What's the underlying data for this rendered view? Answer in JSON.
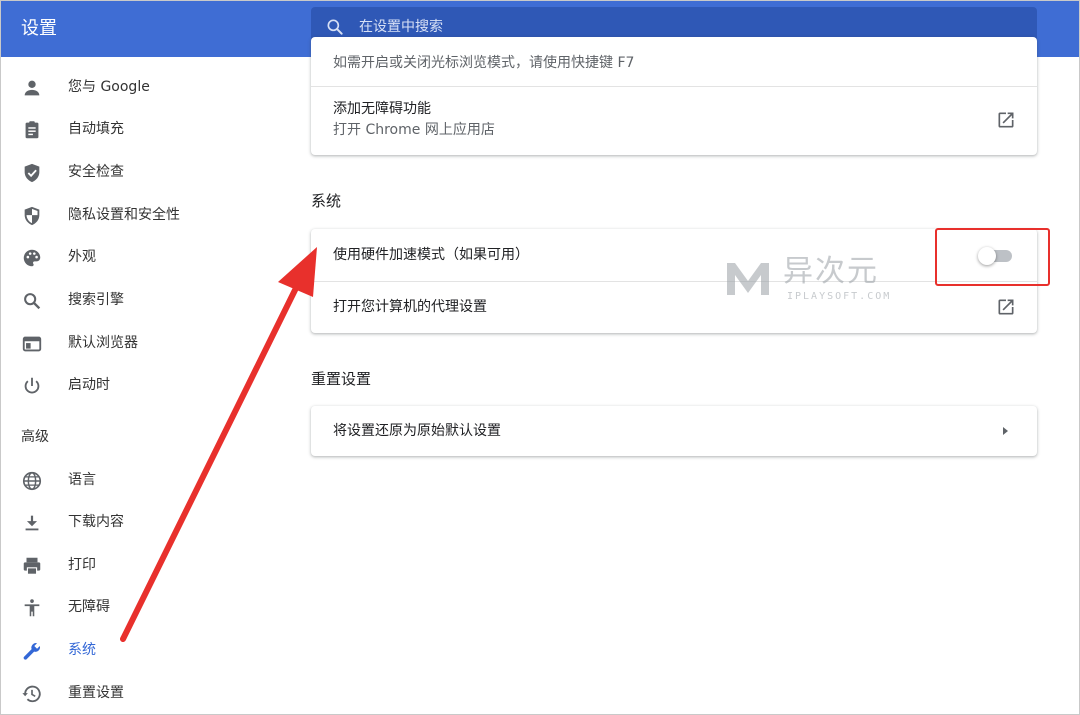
{
  "app": {
    "title": "设置"
  },
  "search": {
    "placeholder": "在设置中搜索"
  },
  "sidebar": {
    "items": [
      {
        "label": "您与 Google",
        "icon": "person-icon"
      },
      {
        "label": "自动填充",
        "icon": "clipboard-icon"
      },
      {
        "label": "安全检查",
        "icon": "shield-check-icon"
      },
      {
        "label": "隐私设置和安全性",
        "icon": "shield-half-icon"
      },
      {
        "label": "外观",
        "icon": "palette-icon"
      },
      {
        "label": "搜索引擎",
        "icon": "search-icon"
      },
      {
        "label": "默认浏览器",
        "icon": "browser-icon"
      },
      {
        "label": "启动时",
        "icon": "power-icon"
      }
    ],
    "advanced_label": "高级",
    "advanced_items": [
      {
        "label": "语言",
        "icon": "globe-icon"
      },
      {
        "label": "下载内容",
        "icon": "download-icon"
      },
      {
        "label": "打印",
        "icon": "printer-icon"
      },
      {
        "label": "无障碍",
        "icon": "accessibility-icon"
      },
      {
        "label": "系统",
        "icon": "wrench-icon",
        "active": true
      },
      {
        "label": "重置设置",
        "icon": "history-icon"
      }
    ]
  },
  "main": {
    "accessibility_card": {
      "partial_text": "如需开启或关闭光标浏览模式，请使用快捷键 F7",
      "add_title": "添加无障碍功能",
      "add_subtitle": "打开 Chrome 网上应用店"
    },
    "system_section": {
      "title": "系统",
      "hardware_accel_label": "使用硬件加速模式（如果可用）",
      "hardware_accel_enabled": false,
      "proxy_label": "打开您计算机的代理设置"
    },
    "reset_section": {
      "title": "重置设置",
      "reset_label": "将设置还原为原始默认设置"
    }
  },
  "watermark": {
    "brand": "异次元",
    "site": "IPLAYSOFT.COM"
  },
  "colors": {
    "topbar": "#3f6dd4",
    "search_bg": "#2f58b6",
    "accent": "#3367d6",
    "annotation": "#e8302c"
  }
}
